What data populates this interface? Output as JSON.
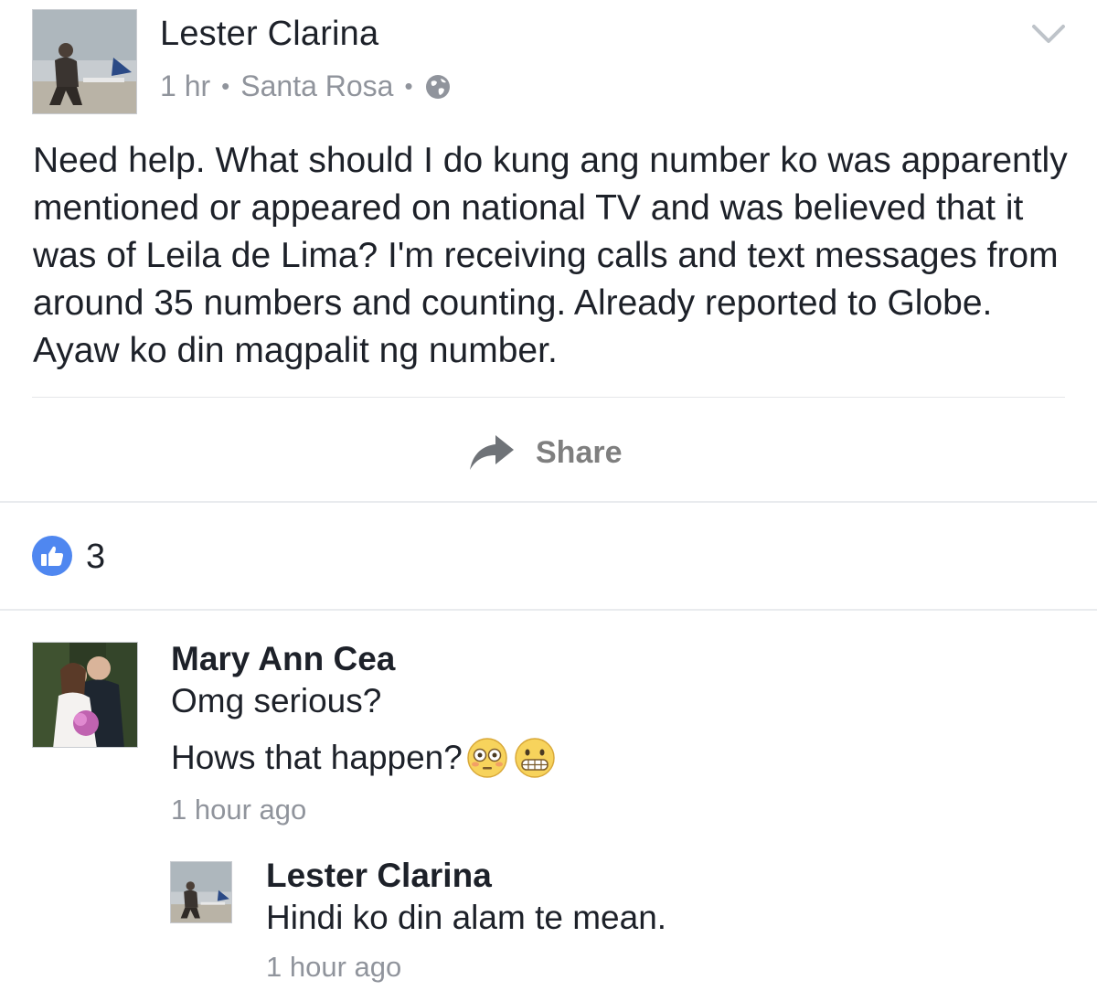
{
  "post": {
    "author": "Lester Clarina",
    "time": "1 hr",
    "location": "Santa Rosa",
    "text": "Need help. What should I do kung ang number ko was apparently mentioned or appeared on national TV and was believed that it was of Leila de Lima? I'm receiving calls and text messages from around 35 numbers and counting. Already reported to Globe. Ayaw ko din magpalit ng number.",
    "share_label": "Share",
    "privacy_icon": "globe-icon",
    "options_icon": "chevron-down-icon"
  },
  "reactions": {
    "icon": "like-icon",
    "count": "3"
  },
  "comments": [
    {
      "author": "Mary Ann Cea",
      "line1": "Omg serious?",
      "line2": "Hows that happen?",
      "emojis": [
        "flushed-face-emoji",
        "grimacing-face-emoji"
      ],
      "time": "1 hour ago"
    },
    {
      "author": "Lester Clarina",
      "line1": "Hindi ko din alam te mean.",
      "time": "1 hour ago"
    }
  ],
  "colors": {
    "text": "#1d2129",
    "meta": "#90949c",
    "like_blue": "#4f87f0",
    "share_gray": "#7f7f7f"
  }
}
